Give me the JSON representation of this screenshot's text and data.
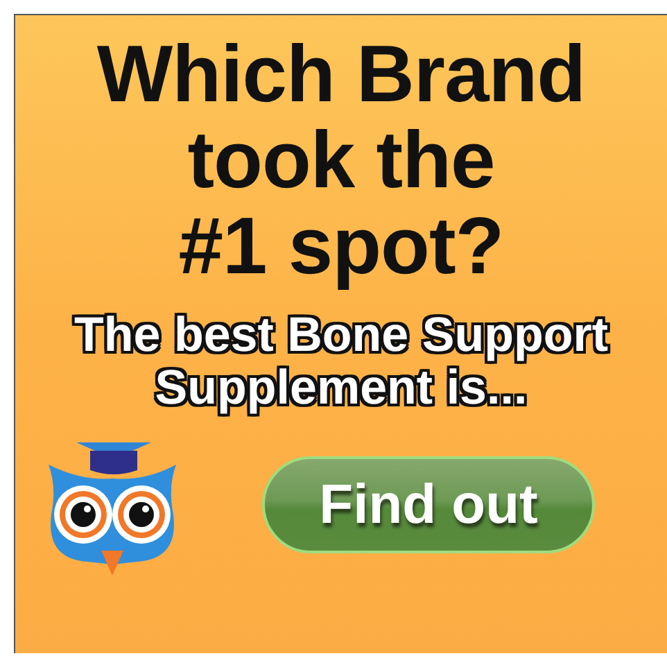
{
  "ad": {
    "headline_lines": [
      "Which Brand",
      "took the",
      "#1 spot?"
    ],
    "subtitle_lines": [
      "The best Bone Support",
      "Supplement is..."
    ],
    "button": {
      "label": "Find out"
    }
  }
}
